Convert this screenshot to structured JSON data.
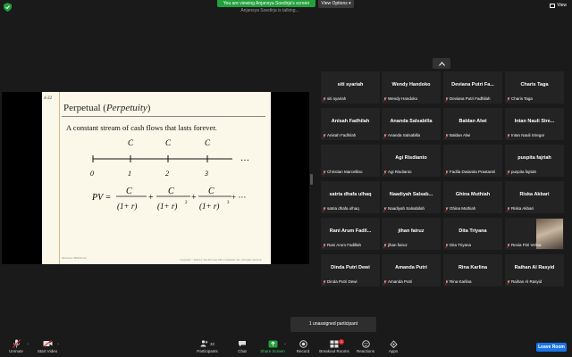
{
  "top_bar": {
    "viewing_banner": "You are viewing Anjansya Soedirja's screen",
    "viewing_sub": "Anjansya Soedirja is talking...",
    "view_options": "View Options",
    "view_label": "View"
  },
  "slide": {
    "number": "4-22",
    "title_prefix": "Perpetual (",
    "title_italic": "Perpetuity",
    "title_suffix": ")",
    "body": "A constant stream of cash flows that lasts forever.",
    "cash_flow_label": "C",
    "ellipsis": "…",
    "timeline_ticks": [
      "0",
      "1",
      "2",
      "3"
    ],
    "formula_lhs": "PV =",
    "formula_numerator": "C",
    "formula_den_base": "(1+ r)",
    "formula_exp2": "2",
    "formula_exp3": "3",
    "formula_tail": "+ ···",
    "footer_left": "McGraw-Hill/Irwin",
    "footer_right": "Copyright © 2004 by The McGraw-Hill Companies, Inc.  All rights reserved."
  },
  "gallery": {
    "tiles": [
      {
        "name": "siti syariah",
        "label": "siti syariah"
      },
      {
        "name": "Wendy Handoko",
        "label": "Wendy Handoko"
      },
      {
        "name": "Deviana Putri Fa...",
        "label": "Deviana Putri Fadhilah"
      },
      {
        "name": "Charis Taga",
        "label": "Charis Taga"
      },
      {
        "name": "Anisah Fadhilah",
        "label": "Anisah Fadhilah"
      },
      {
        "name": "Ananda Salsabilla",
        "label": "Ananda Salsabilla"
      },
      {
        "name": "Baldan Alwi",
        "label": "Baldan Alwi"
      },
      {
        "name": "Intan Nauli Sire...",
        "label": "Intan Nauli Siregar"
      },
      {
        "name": "",
        "label": "Christian Marcellino"
      },
      {
        "name": "Agi Risdianto",
        "label": "Agi Risdianto"
      },
      {
        "name": "",
        "label": "Fadila Dwianita Prastantri"
      },
      {
        "name": "puspita fajriah",
        "label": "puspita fajriah"
      },
      {
        "name": "satria dhafa ulhaq",
        "label": "satria dhafa ulhaq"
      },
      {
        "name": "Naadiyah Salsab...",
        "label": "Naadiyah Salsabilah"
      },
      {
        "name": "Ghina Muthiah",
        "label": "Ghina Muthiah"
      },
      {
        "name": "Riska Akbari",
        "label": "Riska Akbari"
      },
      {
        "name": "Rani Arum Fadil...",
        "label": "Rani Arum Fadillah"
      },
      {
        "name": "jihan fairuz",
        "label": "jihan fairuz"
      },
      {
        "name": "Dita Triyana",
        "label": "Dita Triyana"
      },
      {
        "name": "",
        "label": "Revia Fitri Velisa"
      },
      {
        "name": "Dinda Putri Dewi",
        "label": "Dinda Putri Dewi"
      },
      {
        "name": "Amanda Putri",
        "label": "Amanda Putri"
      },
      {
        "name": "Rina Karlina",
        "label": "Rina Karlina"
      },
      {
        "name": "Raihan Al Rasyid",
        "label": "Raihan Al Rasyid"
      }
    ]
  },
  "toast": "1 unassigned participant",
  "toolbar": {
    "unmute": "Unmute",
    "start_video": "Start Video",
    "participants": "Participants",
    "participant_count": "32",
    "chat": "Chat",
    "share_screen": "Share Screen",
    "record": "Record",
    "breakout_rooms": "Breakout Rooms",
    "breakout_badge": "1",
    "reactions": "Reactions",
    "apps": "Apps",
    "leave": "Leave Room"
  },
  "colors": {
    "banner_green": "#23a03c",
    "leave_blue": "#1a74e8",
    "muted_red": "#e02828"
  }
}
